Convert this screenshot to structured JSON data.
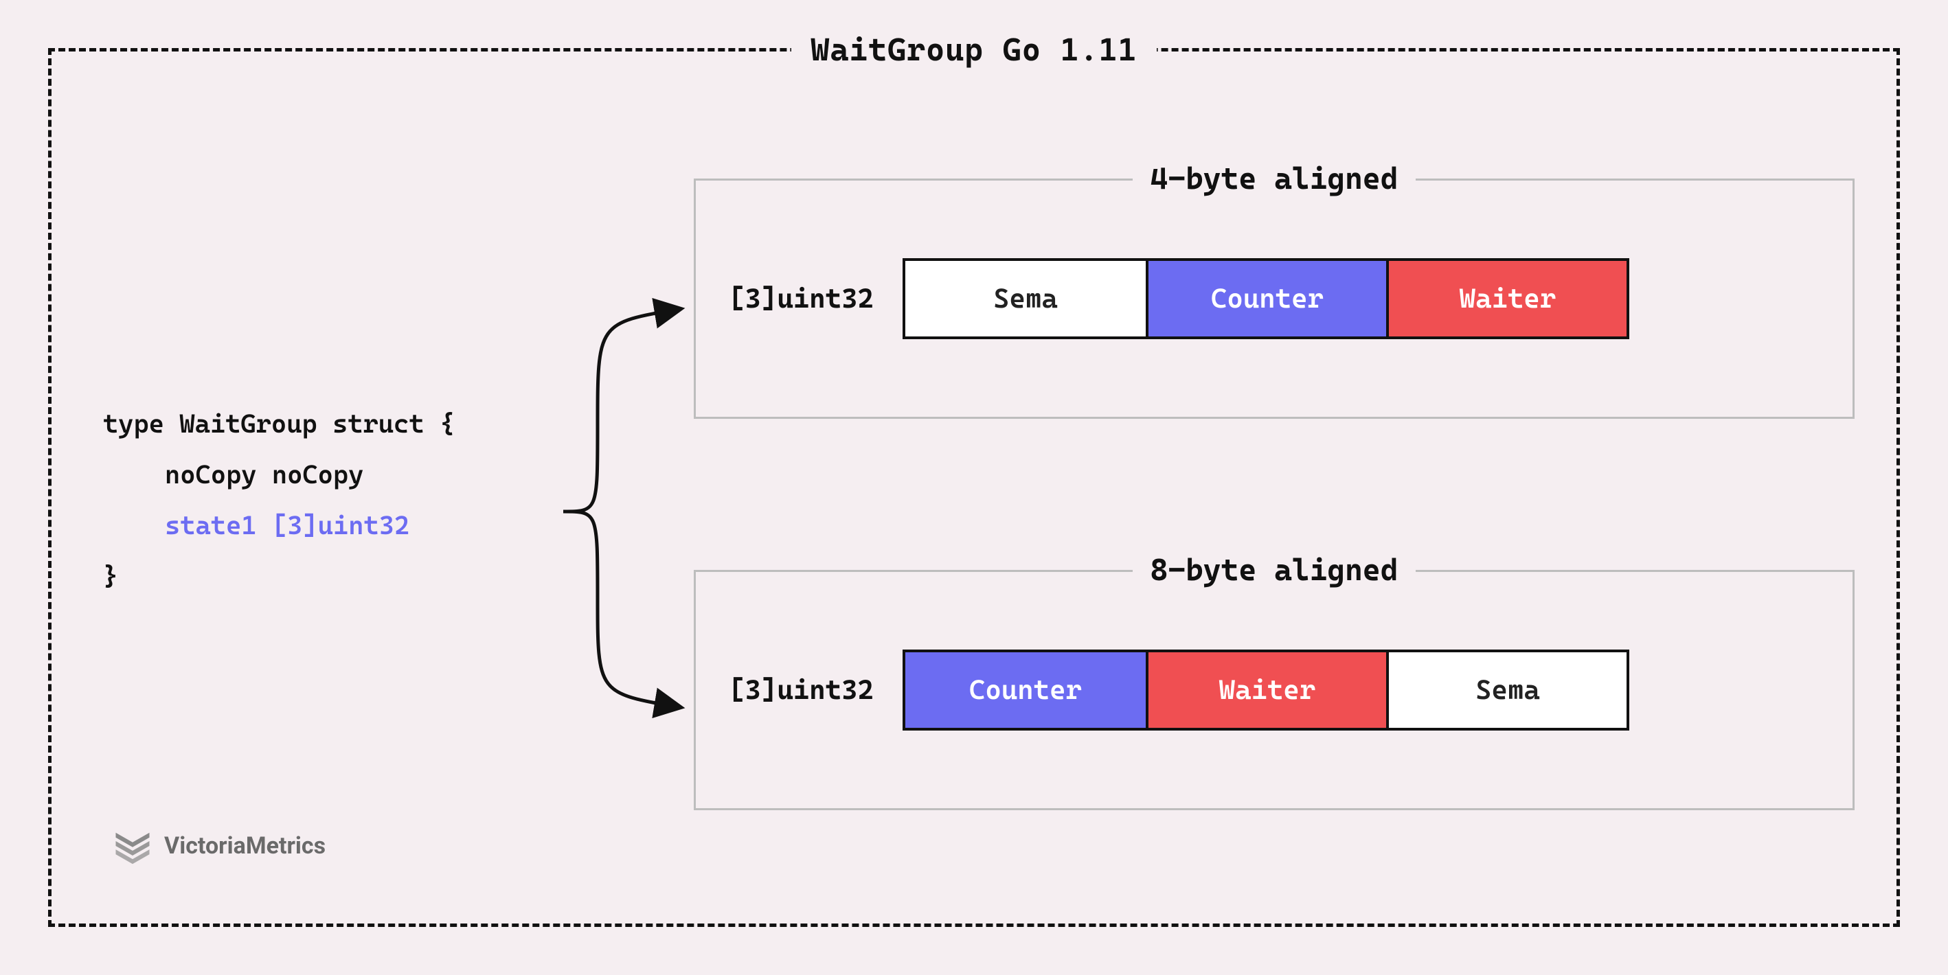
{
  "title": "WaitGroup Go 1.11",
  "code": {
    "line1": "type WaitGroup struct {",
    "line2": "noCopy noCopy",
    "line3": "state1 [3]uint32",
    "line4": "}"
  },
  "group4": {
    "title": "4-byte aligned",
    "arrayLabel": "[3]uint32",
    "cells": [
      "Sema",
      "Counter",
      "Waiter"
    ]
  },
  "group8": {
    "title": "8-byte aligned",
    "arrayLabel": "[3]uint32",
    "cells": [
      "Counter",
      "Waiter",
      "Sema"
    ]
  },
  "colors": {
    "purple": "#6c6cf2",
    "red": "#f04f52",
    "white": "#ffffff",
    "frameDash": "#111111",
    "groupBorder": "#bdbdbd",
    "bg": "#f5eef1"
  },
  "logo": {
    "text": "VictoriaMetrics"
  }
}
